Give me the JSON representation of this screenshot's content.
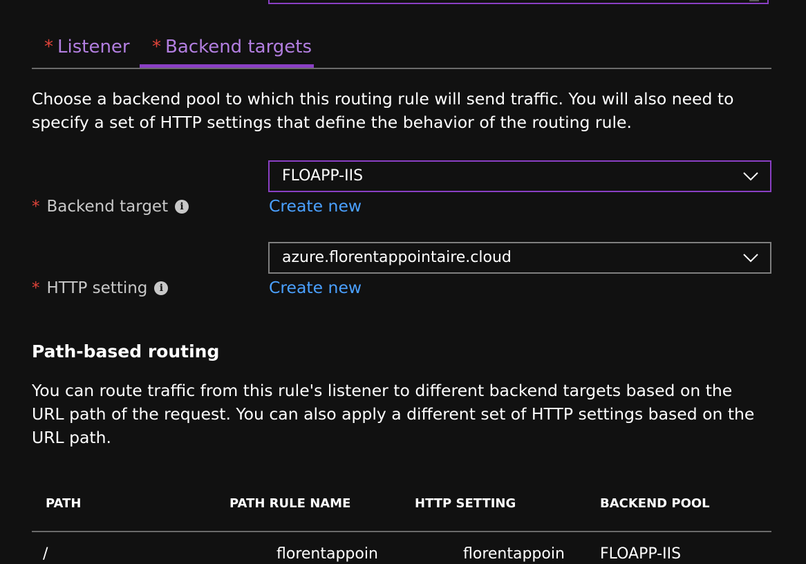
{
  "tabs": [
    {
      "required": "*",
      "label": "Listener"
    },
    {
      "required": "*",
      "label": "Backend targets"
    }
  ],
  "description": "Choose a backend pool to which this routing rule will send traffic. You will also need to specify a set of HTTP settings that define the behavior of the routing rule.",
  "backend_target": {
    "required": "*",
    "label": "Backend target",
    "info_icon": "i",
    "value": "FLOAPP-IIS",
    "create_new": "Create new"
  },
  "http_setting": {
    "required": "*",
    "label": "HTTP setting",
    "info_icon": "i",
    "value": "azure.florentappointaire.cloud",
    "create_new": "Create new"
  },
  "path_routing": {
    "title": "Path-based routing",
    "description": "You can route traffic from this rule's listener to different backend targets based on the URL path of the request. You can also apply a different set of HTTP settings based on the URL path.",
    "columns": [
      "PATH",
      "PATH RULE NAME",
      "HTTP SETTING",
      "BACKEND POOL"
    ],
    "rows": [
      {
        "path": "/",
        "rule_name": "florentappoin",
        "http_setting": "florentappoin",
        "backend_pool": "FLOAPP-IIS"
      }
    ]
  },
  "colors": {
    "accent": "#8a3fc4",
    "tab_text": "#b27ee0",
    "required": "#e0443a",
    "link": "#4aa0ff",
    "background": "#111111"
  }
}
